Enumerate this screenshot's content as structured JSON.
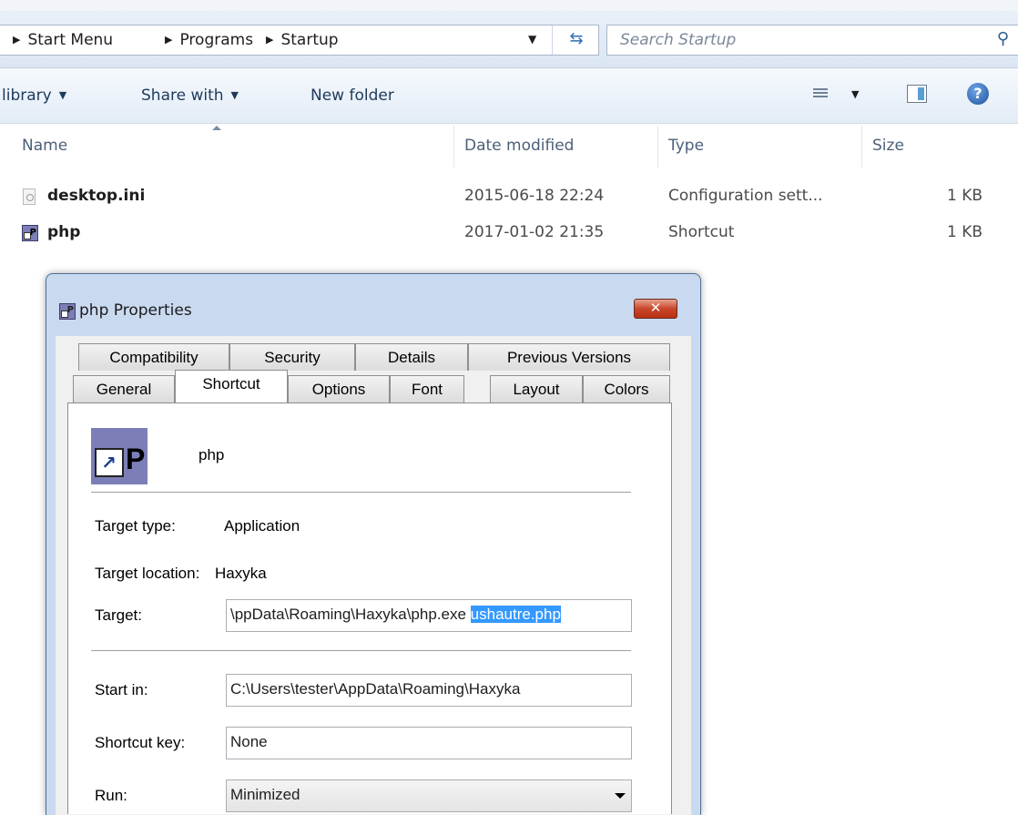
{
  "breadcrumb": {
    "items": [
      "Start Menu",
      "Programs",
      "Startup"
    ]
  },
  "search": {
    "placeholder": "Search Startup"
  },
  "toolbar": {
    "include_library": "library",
    "share_with": "Share with",
    "new_folder": "New folder"
  },
  "columns": [
    "Name",
    "Date modified",
    "Type",
    "Size"
  ],
  "files": [
    {
      "name": "desktop.ini",
      "date": "2015-06-18 22:24",
      "type": "Configuration sett...",
      "size": "1 KB",
      "icon": "settings-file-icon"
    },
    {
      "name": "php",
      "date": "2017-01-02 21:35",
      "type": "Shortcut",
      "size": "1 KB",
      "icon": "php-shortcut-icon"
    }
  ],
  "dialog": {
    "title": "php Properties",
    "close": "✕",
    "tabs_row1": [
      "Compatibility",
      "Security",
      "Details",
      "Previous Versions"
    ],
    "tabs_row2": [
      "General",
      "Shortcut",
      "Options",
      "Font",
      "Layout",
      "Colors"
    ],
    "active_tab": "Shortcut",
    "shortcut_name": "php",
    "target_type_label": "Target type:",
    "target_type_value": "Application",
    "target_location_label": "Target location:",
    "target_location_value": "Haxyka",
    "target_label": "Target:",
    "target_value_plain": "\\ppData\\Roaming\\Haxyka\\php.exe ",
    "target_value_selected": "ushautre.php",
    "start_in_label": "Start in:",
    "start_in_value": "C:\\Users\\tester\\AppData\\Roaming\\Haxyka",
    "shortcut_key_label": "Shortcut key:",
    "shortcut_key_value": "None",
    "run_label": "Run:",
    "run_value": "Minimized"
  },
  "colors": {
    "selection": "#3399ff",
    "dialog_frame": "#c9daf0",
    "close_button": "#c9462b"
  }
}
